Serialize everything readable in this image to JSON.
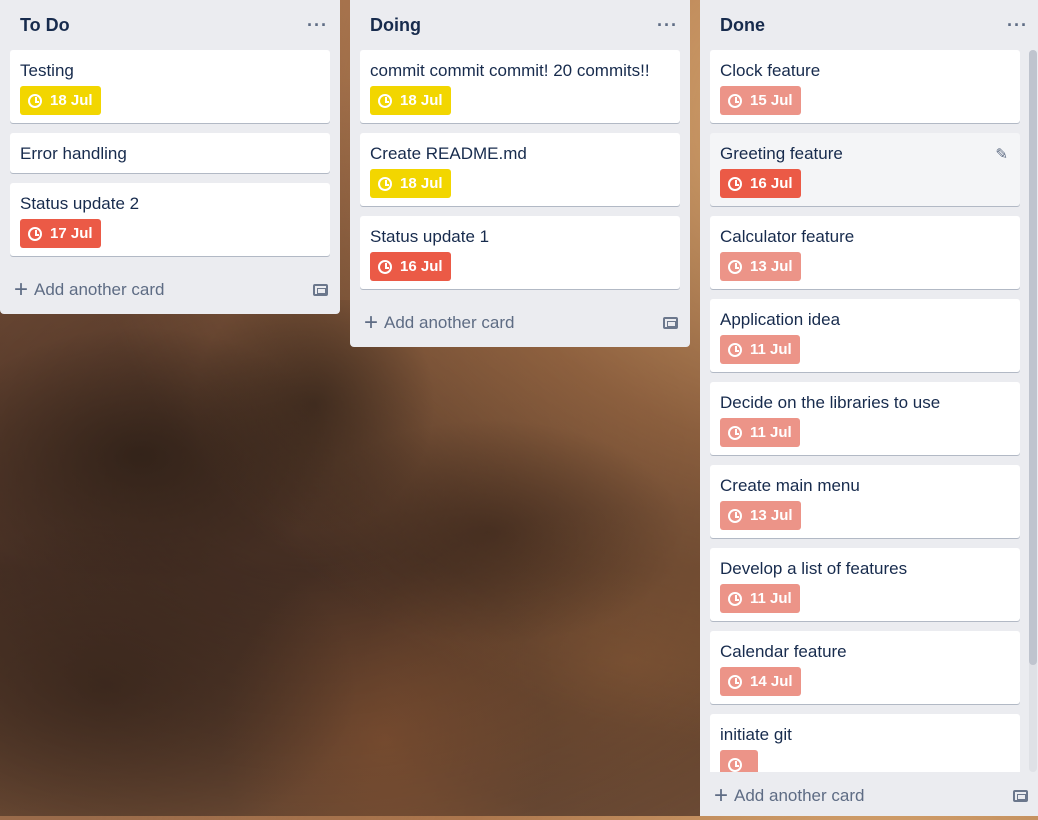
{
  "lists": [
    {
      "title": "To Do",
      "menu": "···",
      "add_label": "Add another card",
      "cards": [
        {
          "title": "Testing",
          "due": "18 Jul",
          "badge_color": "#f2d600"
        },
        {
          "title": "Error handling",
          "due": null
        },
        {
          "title": "Status update 2",
          "due": "17 Jul",
          "badge_color": "#eb5a46"
        }
      ]
    },
    {
      "title": "Doing",
      "menu": "···",
      "add_label": "Add another card",
      "cards": [
        {
          "title": "commit commit commit! 20 commits!!",
          "due": "18 Jul",
          "badge_color": "#f2d600"
        },
        {
          "title": "Create README.md",
          "due": "18 Jul",
          "badge_color": "#f2d600"
        },
        {
          "title": "Status update 1",
          "due": "16 Jul",
          "badge_color": "#eb5a46"
        }
      ]
    },
    {
      "title": "Done",
      "menu": "···",
      "add_label": "Add another card",
      "cards": [
        {
          "title": "Clock feature",
          "due": "15 Jul",
          "badge_color": "#ec9488"
        },
        {
          "title": "Greeting feature",
          "due": "16 Jul",
          "badge_color": "#eb5a46"
        },
        {
          "title": "Calculator feature",
          "due": "13 Jul",
          "badge_color": "#ec9488"
        },
        {
          "title": "Application idea",
          "due": "11 Jul",
          "badge_color": "#ec9488"
        },
        {
          "title": "Decide on the libraries to use",
          "due": "11 Jul",
          "badge_color": "#ec9488"
        },
        {
          "title": "Create main menu",
          "due": "13 Jul",
          "badge_color": "#ec9488"
        },
        {
          "title": "Develop a list of features",
          "due": "11 Jul",
          "badge_color": "#ec9488"
        },
        {
          "title": "Calendar feature",
          "due": "14 Jul",
          "badge_color": "#ec9488"
        },
        {
          "title": "initiate git",
          "due": "",
          "badge_color": "#ec9488"
        }
      ]
    }
  ]
}
